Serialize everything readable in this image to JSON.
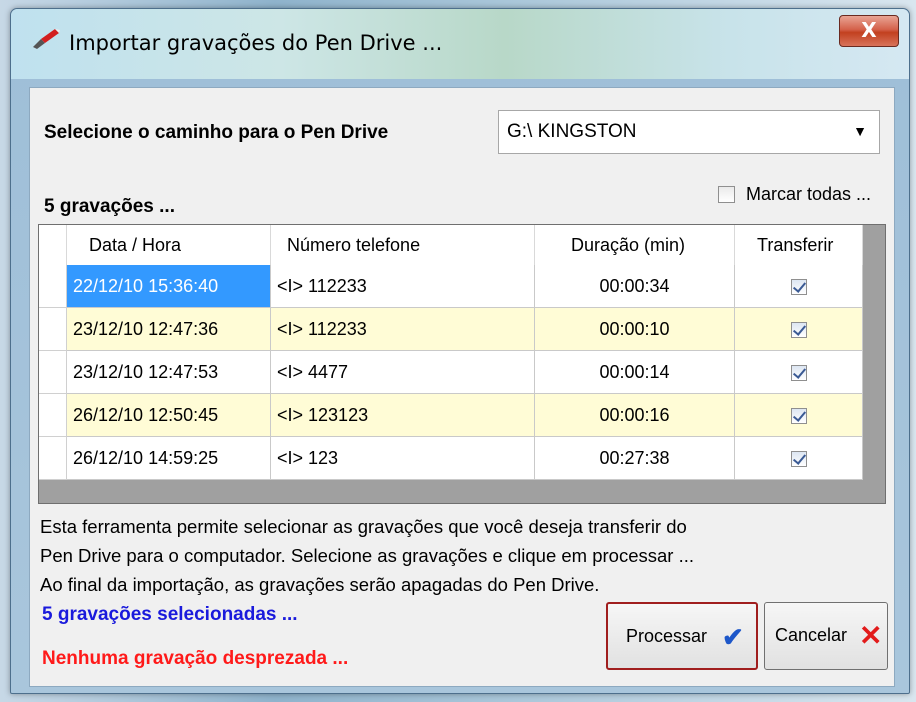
{
  "window": {
    "title": "Importar gravações do Pen Drive ...",
    "close_glyph": "X"
  },
  "path": {
    "label": "Selecione o caminho para o Pen Drive",
    "selected": "G:\\ KINGSTON"
  },
  "recordings": {
    "count_label": "5 gravações ...",
    "mark_all_label": "Marcar todas ..."
  },
  "table": {
    "columns": [
      "Data / Hora",
      "Número telefone",
      "Duração (min)",
      "Transferir"
    ],
    "rows": [
      {
        "datetime": "22/12/10 15:36:40",
        "phone": "<I> 112233",
        "duration": "00:00:34",
        "transfer": true
      },
      {
        "datetime": "23/12/10 12:47:36",
        "phone": "<I> 112233",
        "duration": "00:00:10",
        "transfer": true
      },
      {
        "datetime": "23/12/10 12:47:53",
        "phone": "<I> 4477",
        "duration": "00:00:14",
        "transfer": true
      },
      {
        "datetime": "26/12/10 12:50:45",
        "phone": "<I> 123123",
        "duration": "00:00:16",
        "transfer": true
      },
      {
        "datetime": "26/12/10 14:59:25",
        "phone": "<I> 123",
        "duration": "00:27:38",
        "transfer": true
      }
    ]
  },
  "description": {
    "line1": "Esta ferramenta permite selecionar as gravações que você deseja transferir do",
    "line2": "Pen Drive para o computador. Selecione as gravações e clique em processar ...",
    "line3": "Ao final da importação, as gravações serão apagadas do Pen Drive."
  },
  "status": {
    "selected": "5 gravações selecionadas ...",
    "discarded": "Nenhuma gravação desprezada ..."
  },
  "buttons": {
    "process": "Processar",
    "cancel": "Cancelar"
  },
  "icons": {
    "app": "pen-drive-icon",
    "process": "checkmark-icon",
    "cancel": "x-icon"
  },
  "colors": {
    "selected_text": "#1a1adc",
    "discard_text": "#ff1a1a",
    "alt_row": "#fffcd6",
    "selection": "#3399ff"
  }
}
